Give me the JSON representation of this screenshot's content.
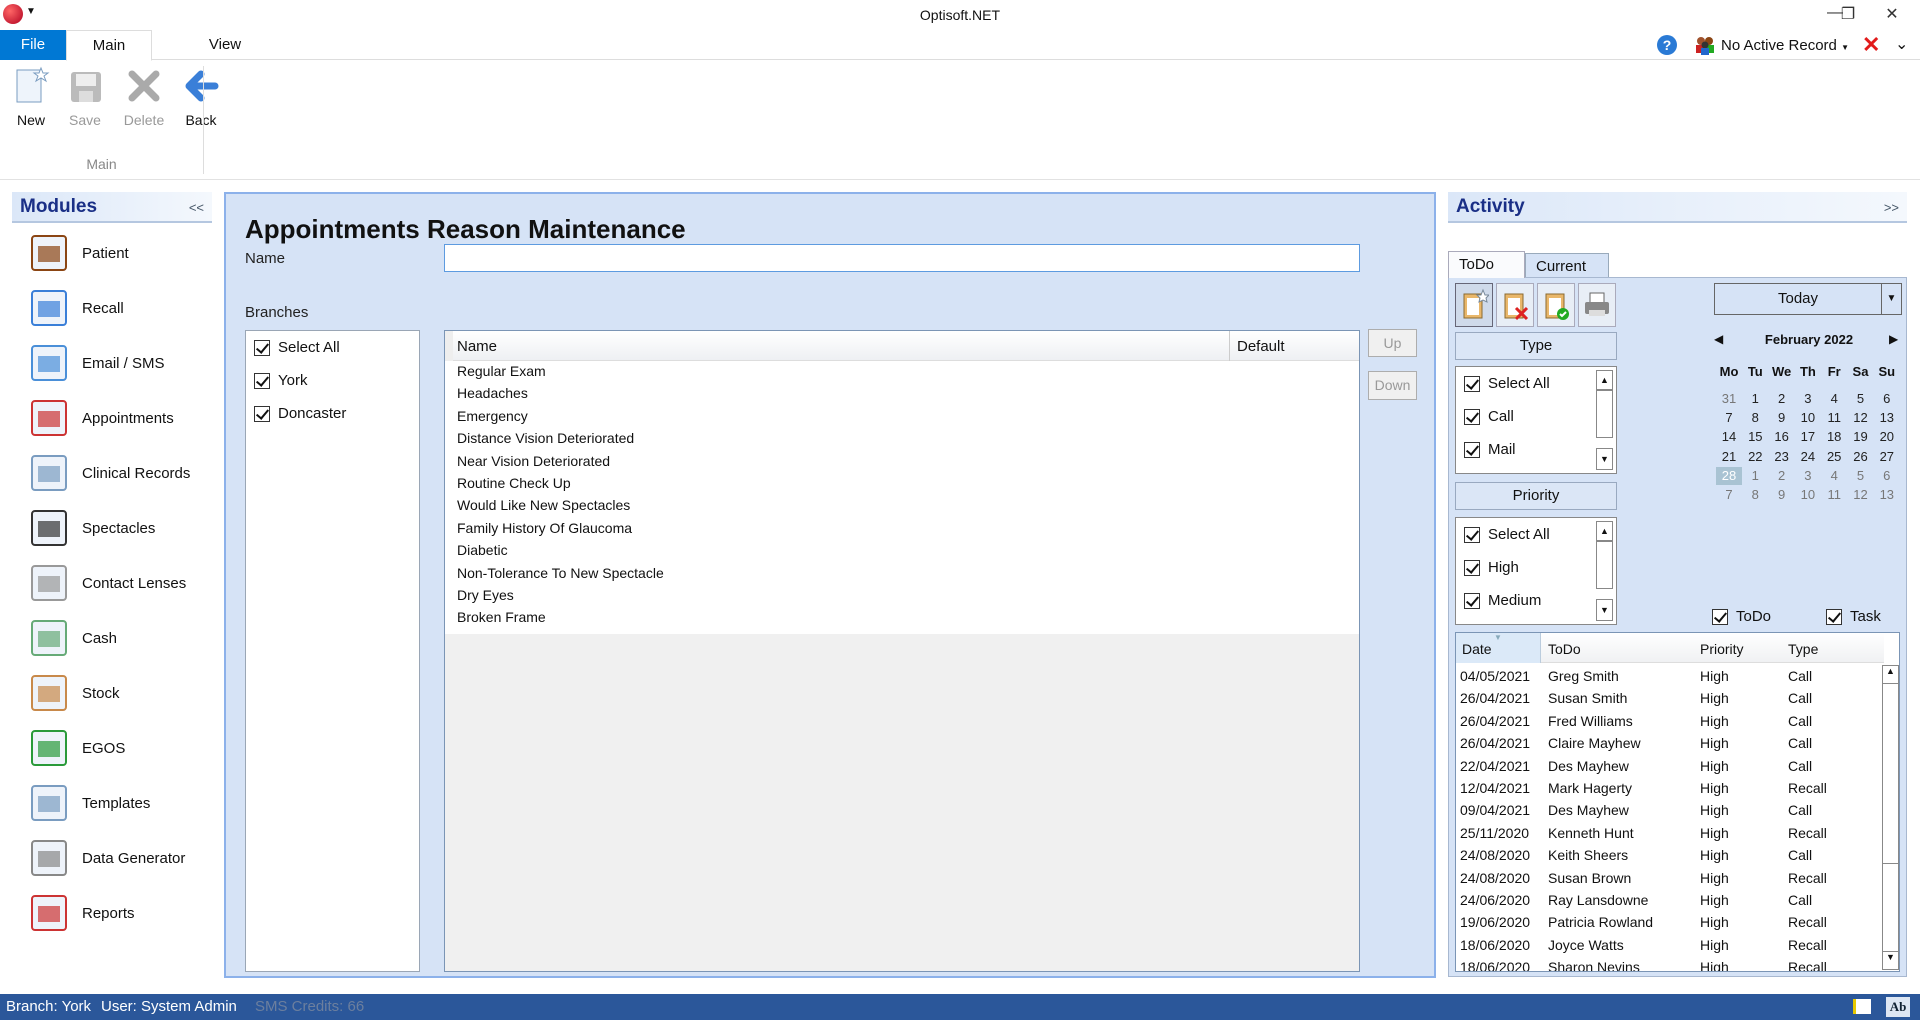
{
  "window": {
    "title": "Optisoft.NET",
    "minimize": "—",
    "restore": "❐",
    "close": "✕"
  },
  "ribbon_tabs": [
    {
      "label": "File"
    },
    {
      "label": "Main"
    },
    {
      "label": "View"
    }
  ],
  "header_right": {
    "active_record": "No Active Record"
  },
  "ribbon": {
    "buttons": [
      {
        "label": "New",
        "enabled": true
      },
      {
        "label": "Save",
        "enabled": false
      },
      {
        "label": "Delete",
        "enabled": false
      },
      {
        "label": "Back",
        "enabled": true
      }
    ],
    "group_label": "Main"
  },
  "modules": {
    "title": "Modules",
    "collapse": "<<",
    "items": [
      {
        "label": "Patient",
        "icon": "patient-icon"
      },
      {
        "label": "Recall",
        "icon": "recall-chart-icon"
      },
      {
        "label": "Email / SMS",
        "icon": "email-sms-icon"
      },
      {
        "label": "Appointments",
        "icon": "appointments-clock-icon"
      },
      {
        "label": "Clinical Records",
        "icon": "clinical-records-icon"
      },
      {
        "label": "Spectacles",
        "icon": "spectacles-icon"
      },
      {
        "label": "Contact Lenses",
        "icon": "contact-lenses-icon"
      },
      {
        "label": "Cash",
        "icon": "cash-register-icon"
      },
      {
        "label": "Stock",
        "icon": "stock-box-icon"
      },
      {
        "label": "EGOS",
        "icon": "egos-icon"
      },
      {
        "label": "Templates",
        "icon": "templates-icon"
      },
      {
        "label": "Data Generator",
        "icon": "data-generator-icon"
      },
      {
        "label": "Reports",
        "icon": "reports-icon"
      }
    ]
  },
  "form": {
    "title": "Appointments Reason Maintenance",
    "name_label": "Name",
    "name_value": "",
    "branches_label": "Branches",
    "branches": [
      {
        "label": "Select All",
        "checked": true
      },
      {
        "label": "York",
        "checked": true
      },
      {
        "label": "Doncaster",
        "checked": true
      }
    ],
    "grid": {
      "columns": [
        "Name",
        "Default"
      ],
      "rows": [
        "Regular Exam",
        "Headaches",
        "Emergency",
        "Distance Vision Deteriorated",
        "Near Vision Deteriorated",
        "Routine Check Up",
        "Would Like New Spectacles",
        "Family History Of Glaucoma",
        "Diabetic",
        "Non-Tolerance To New Spectacle",
        "Dry Eyes",
        "Broken Frame"
      ]
    },
    "up_label": "Up",
    "down_label": "Down"
  },
  "activity": {
    "title": "Activity",
    "expand": ">>",
    "tabs": [
      "ToDo",
      "Current"
    ],
    "type_label": "Type",
    "types": [
      {
        "label": "Select All",
        "checked": true
      },
      {
        "label": "Call",
        "checked": true
      },
      {
        "label": "Mail",
        "checked": true
      }
    ],
    "priority_label": "Priority",
    "priorities": [
      {
        "label": "Select All",
        "checked": true
      },
      {
        "label": "High",
        "checked": true
      },
      {
        "label": "Medium",
        "checked": true
      }
    ],
    "today_label": "Today",
    "calendar": {
      "month": "February 2022",
      "days": [
        "Mo",
        "Tu",
        "We",
        "Th",
        "Fr",
        "Sa",
        "Su"
      ],
      "selected": "28",
      "weeks": [
        [
          "31",
          "1",
          "2",
          "3",
          "4",
          "5",
          "6"
        ],
        [
          "7",
          "8",
          "9",
          "10",
          "11",
          "12",
          "13"
        ],
        [
          "14",
          "15",
          "16",
          "17",
          "18",
          "19",
          "20"
        ],
        [
          "21",
          "22",
          "23",
          "24",
          "25",
          "26",
          "27"
        ],
        [
          "28",
          "1",
          "2",
          "3",
          "4",
          "5",
          "6"
        ],
        [
          "7",
          "8",
          "9",
          "10",
          "11",
          "12",
          "13"
        ]
      ]
    },
    "filter_todo": {
      "label": "ToDo",
      "checked": true
    },
    "filter_task": {
      "label": "Task",
      "checked": true
    },
    "grid": {
      "columns": [
        "Date",
        "ToDo",
        "Priority",
        "Type"
      ],
      "rows": [
        [
          "04/05/2021",
          "Greg Smith",
          "High",
          "Call"
        ],
        [
          "26/04/2021",
          "Susan Smith",
          "High",
          "Call"
        ],
        [
          "26/04/2021",
          "Fred Williams",
          "High",
          "Call"
        ],
        [
          "26/04/2021",
          "Claire Mayhew",
          "High",
          "Call"
        ],
        [
          "22/04/2021",
          "Des Mayhew",
          "High",
          "Call"
        ],
        [
          "12/04/2021",
          "Mark Hagerty",
          "High",
          "Recall"
        ],
        [
          "09/04/2021",
          "Des Mayhew",
          "High",
          "Call"
        ],
        [
          "25/11/2020",
          "Kenneth Hunt",
          "High",
          "Recall"
        ],
        [
          "24/08/2020",
          "Keith Sheers",
          "High",
          "Call"
        ],
        [
          "24/08/2020",
          "Susan Brown",
          "High",
          "Recall"
        ],
        [
          "24/06/2020",
          "Ray Lansdowne",
          "High",
          "Call"
        ],
        [
          "19/06/2020",
          "Patricia Rowland",
          "High",
          "Recall"
        ],
        [
          "18/06/2020",
          "Joyce Watts",
          "High",
          "Recall"
        ],
        [
          "18/06/2020",
          "Sharon Nevins",
          "High",
          "Recall"
        ]
      ]
    }
  },
  "status": {
    "branch": "Branch: York",
    "user": "User: System Admin",
    "sms": "SMS Credits: 66"
  },
  "colors": {
    "file_tab": "#0078d4",
    "panel_bg": "#d6e3f6",
    "status_bar": "#2b579a",
    "header_text": "#1a2f86"
  }
}
